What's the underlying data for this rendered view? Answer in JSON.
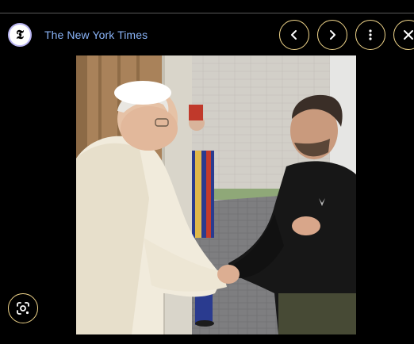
{
  "source": {
    "logo_glyph": "𝕿",
    "name": "The New York Times",
    "name_color": "#8ab4f8",
    "logo_icon": "nyt-logo-icon"
  },
  "controls": {
    "prev_icon": "chevron-left-icon",
    "next_icon": "chevron-right-icon",
    "more_icon": "more-vert-icon",
    "close_icon": "close-icon",
    "accent": "#f0d58a"
  },
  "image": {
    "subject": "photo-main-image"
  },
  "lens": {
    "icon": "lens-search-icon"
  },
  "colors": {
    "background": "#000000",
    "divider": "#5a5a5a"
  }
}
